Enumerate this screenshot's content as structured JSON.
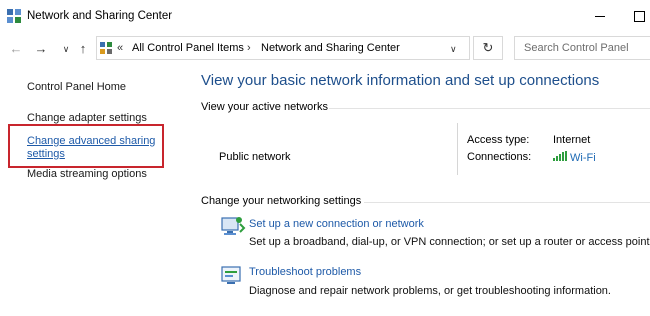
{
  "window": {
    "title": "Network and Sharing Center"
  },
  "address_bar": {
    "overflow_glyph": "«",
    "crumbs": [
      "All Control Panel Items",
      "Network and Sharing Center"
    ],
    "separator": "›"
  },
  "search": {
    "placeholder": "Search Control Panel"
  },
  "sidebar": {
    "items": [
      {
        "label": "Control Panel Home",
        "is_link": false
      },
      {
        "label": "Change adapter settings",
        "is_link": false
      },
      {
        "label_line1": "Change advanced sharing",
        "label_line2": "settings",
        "is_link": true,
        "highlighted": true
      },
      {
        "label": "Media streaming options",
        "is_link": false
      }
    ],
    "highlight_color": "#c8252d"
  },
  "main": {
    "heading": "View your basic network information and set up connections",
    "active_networks": {
      "section_title": "View your active networks",
      "network_name": "Public network",
      "access_type_label": "Access type:",
      "access_type_value": "Internet",
      "connections_label": "Connections:",
      "connection_value": "Wi-Fi"
    },
    "settings": {
      "section_title": "Change your networking settings",
      "tasks": [
        {
          "icon": "new-connection-icon",
          "link": "Set up a new connection or network",
          "description": "Set up a broadband, dial-up, or VPN connection; or set up a router or access point."
        },
        {
          "icon": "troubleshoot-icon",
          "link": "Troubleshoot problems",
          "description": "Diagnose and repair network problems, or get troubleshooting information."
        }
      ]
    }
  },
  "colors": {
    "link": "#1e5aa8",
    "heading": "#1e4f8c",
    "wifi_signal": "#2e9e3e"
  }
}
